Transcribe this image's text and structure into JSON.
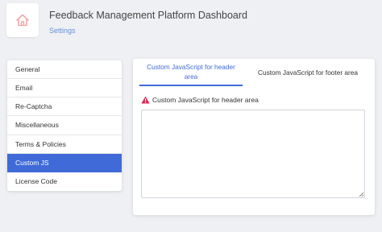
{
  "header": {
    "title": "Feedback Management Platform Dashboard",
    "breadcrumb": "Settings",
    "logo_icon": "home-icon"
  },
  "sidebar": {
    "items": [
      {
        "label": "General",
        "active": false
      },
      {
        "label": "Email",
        "active": false
      },
      {
        "label": "Re-Captcha",
        "active": false
      },
      {
        "label": "Miscellaneous",
        "active": false
      },
      {
        "label": "Terms & Policies",
        "active": false
      },
      {
        "label": "Custom JS",
        "active": true
      },
      {
        "label": "License Code",
        "active": false
      }
    ]
  },
  "tabs": {
    "header_tab": "Custom JavaScript for header area",
    "footer_tab": "Custom JavaScript for footer area",
    "active": "header_tab"
  },
  "form": {
    "label": "Custom JavaScript for header area",
    "label_icon": "warning-icon",
    "value": ""
  },
  "colors": {
    "accent": "#3f6ad8",
    "warning": "#d92550",
    "background": "#eef0f3",
    "logo": "#f1a7a8"
  }
}
